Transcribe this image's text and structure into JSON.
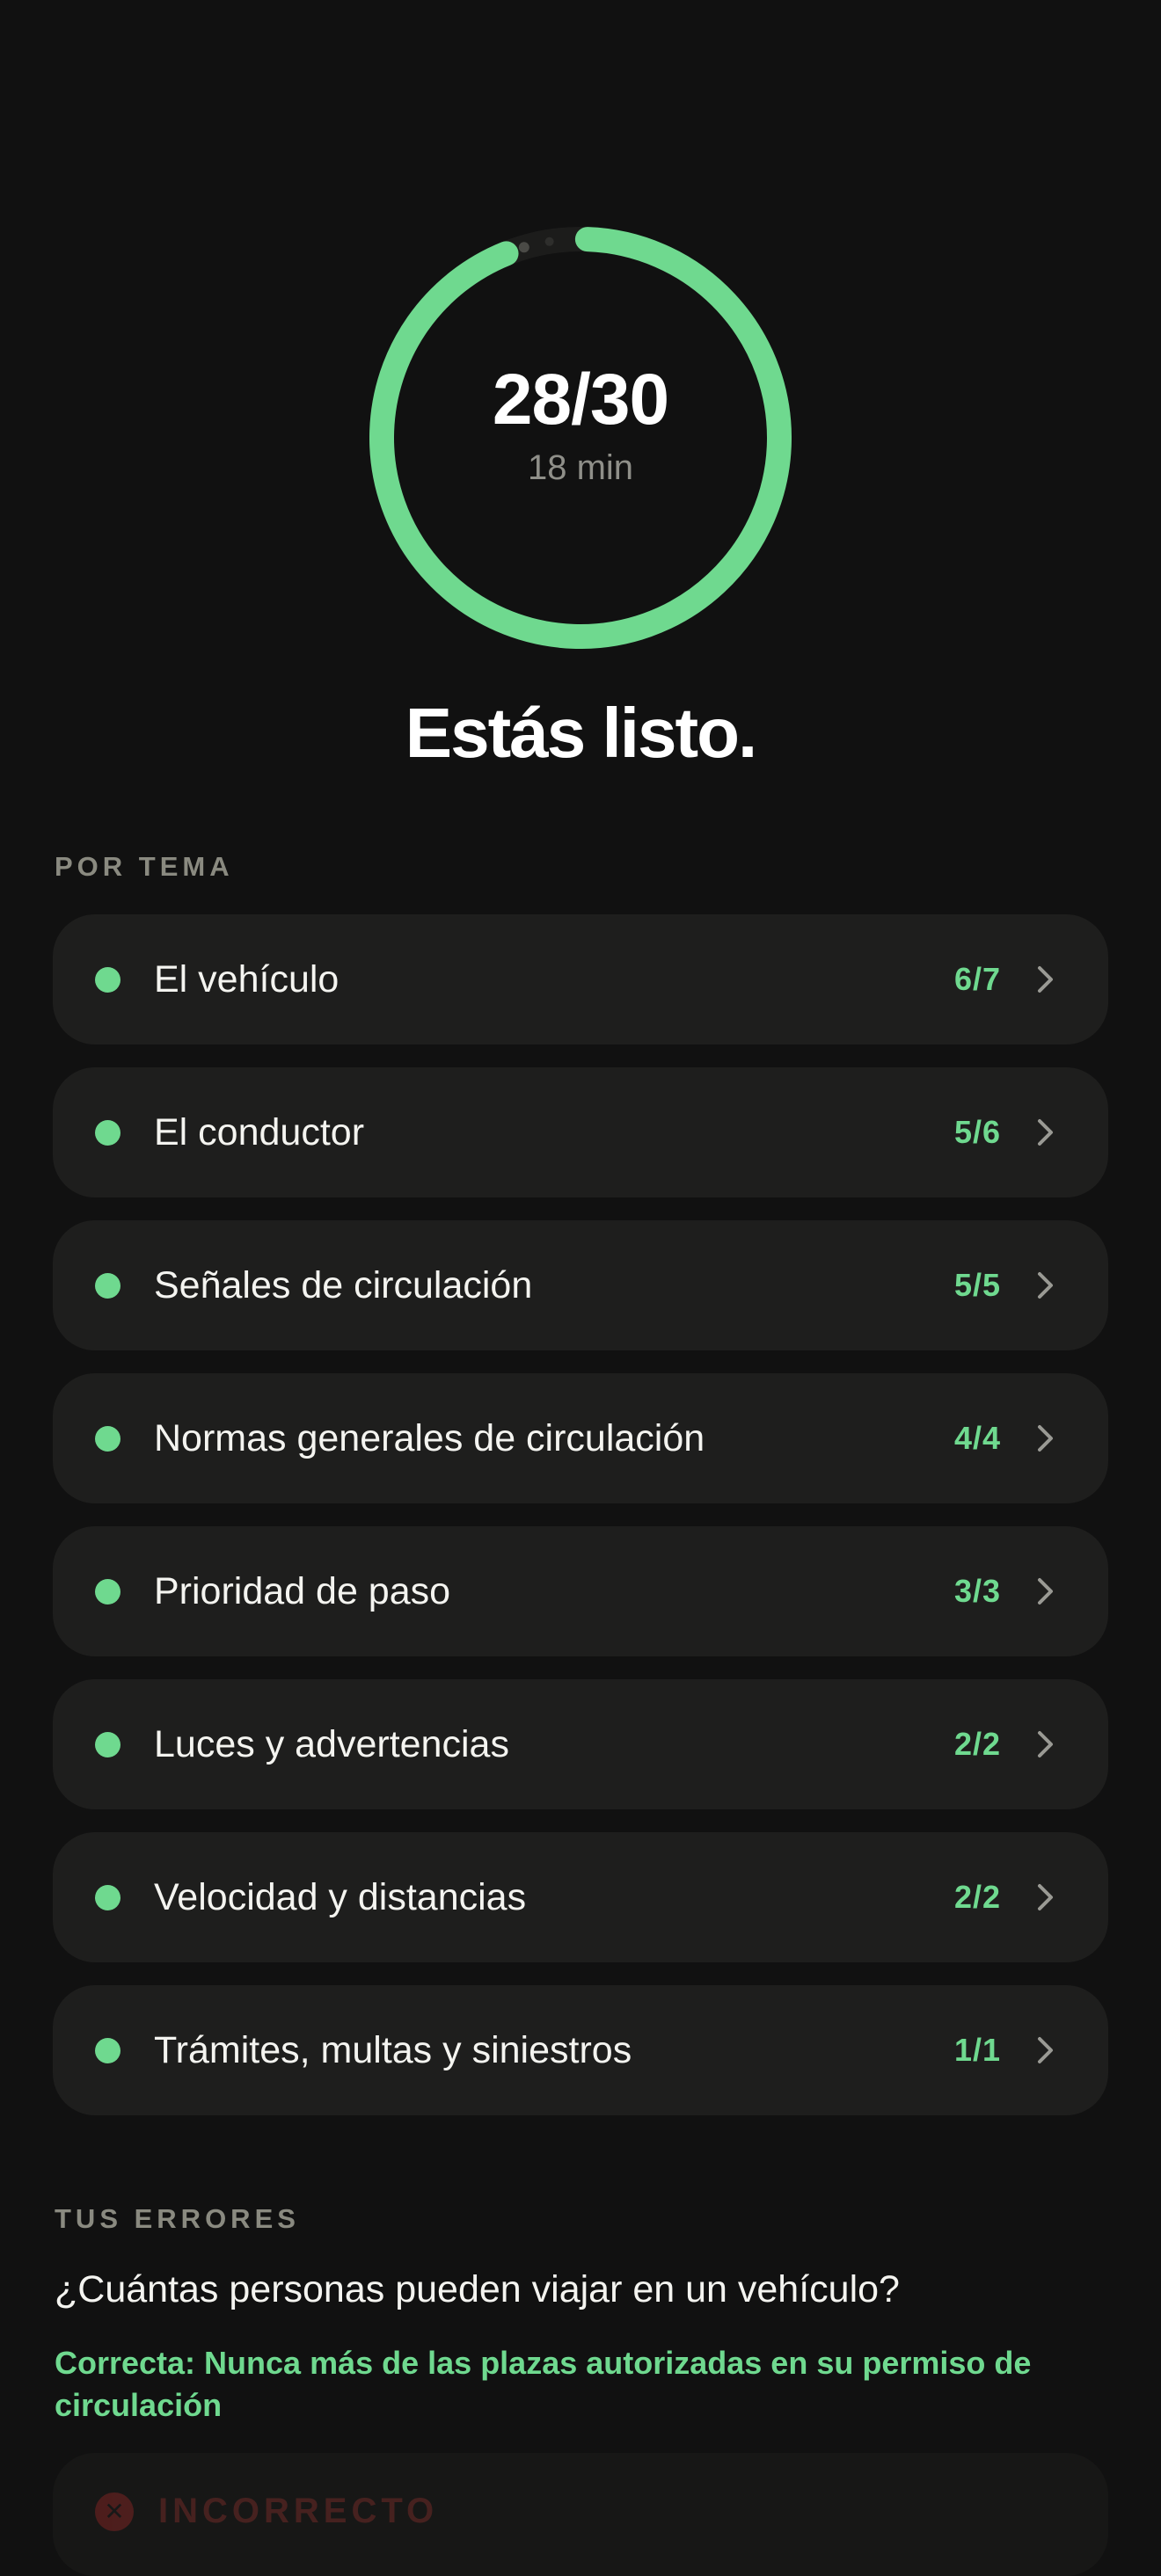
{
  "result": {
    "correct": 28,
    "total": 30,
    "score_text": "28/30",
    "duration": "18 min",
    "headline": "Estás listo."
  },
  "colors": {
    "accent": "#6fd98f",
    "background": "#111111",
    "card": "#1e1e1d",
    "muted": "#8a8a80",
    "error": "#7a2424"
  },
  "topics_section": {
    "label": "POR TEMA",
    "items": [
      {
        "name": "El vehículo",
        "score": "6/7"
      },
      {
        "name": "El conductor",
        "score": "5/6"
      },
      {
        "name": "Señales de circulación",
        "score": "5/5"
      },
      {
        "name": "Normas generales de circulación",
        "score": "4/4"
      },
      {
        "name": "Prioridad de paso",
        "score": "3/3"
      },
      {
        "name": "Luces y advertencias",
        "score": "2/2"
      },
      {
        "name": "Velocidad y distancias",
        "score": "2/2"
      },
      {
        "name": "Trámites, multas y siniestros",
        "score": "1/1"
      }
    ]
  },
  "errors_section": {
    "label": "TUS ERRORES",
    "question": "¿Cuántas personas pueden viajar en un vehículo?",
    "correct_answer": "Correcta: Nunca más de las plazas autorizadas en su permiso de circulación",
    "answer_tag": "INCORRECTO",
    "icons": {
      "chevron": "chevron-right-icon",
      "error": "error-x-icon"
    }
  }
}
